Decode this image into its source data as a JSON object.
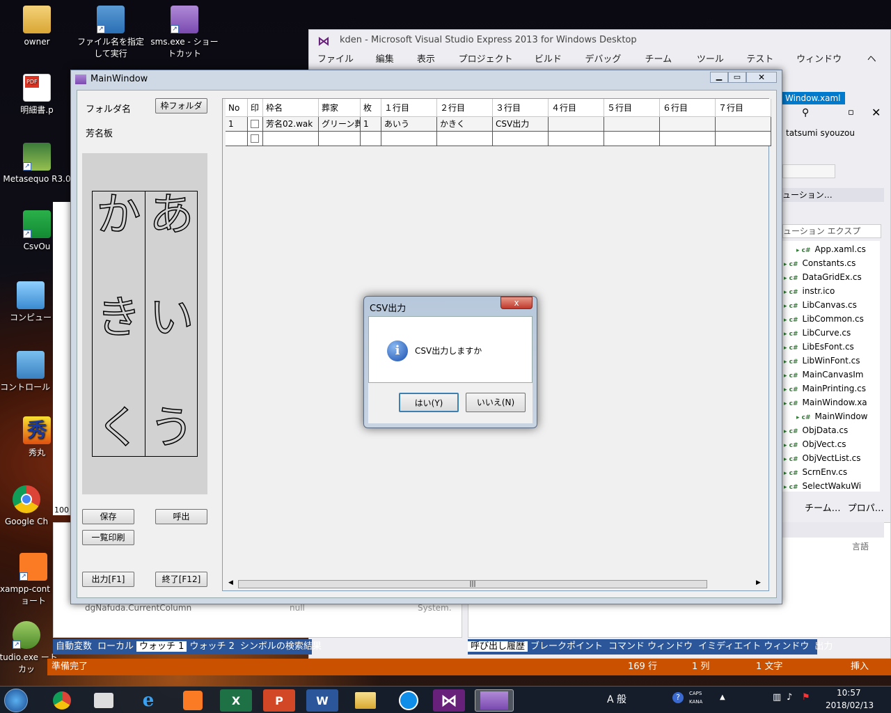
{
  "desktop": {
    "icons": [
      {
        "label": "owner"
      },
      {
        "label": "ファイル名を指定して実行"
      },
      {
        "label": "sms.exe - ショートカット"
      },
      {
        "label": "明細書.p"
      },
      {
        "label": "Metasequo R3.0"
      },
      {
        "label": "CsvOu"
      },
      {
        "label": "コンピュー"
      },
      {
        "label": "コントロール ル"
      },
      {
        "label": "秀丸"
      },
      {
        "label": "Google Ch"
      },
      {
        "label": "xampp-cont - ショート"
      },
      {
        "label": "studio.exe ートカッ"
      }
    ]
  },
  "vs": {
    "title": "kden - Microsoft Visual Studio Express 2013 for Windows Desktop",
    "menu": [
      "ファイル(F)",
      "編集(E)",
      "表示(V)",
      "プロジェクト(P)",
      "ビルド(B)",
      "デバッグ(D)",
      "チーム(M)",
      "ツール(T)",
      "テスト(S)",
      "ウィンドウ(W)",
      "ヘル"
    ],
    "doc_tab": "Window.xaml",
    "user": "tatsumi syouzou",
    "solution_header": "ューション…",
    "solution_search": "ューション エクスプ",
    "files": [
      "App.xaml.cs",
      "Constants.cs",
      "DataGridEx.cs",
      "instr.ico",
      "LibCanvas.cs",
      "LibCommon.cs",
      "LibCurve.cs",
      "LibEsFont.cs",
      "LibWinFont.cs",
      "MainCanvasIm",
      "MainPrinting.cs",
      "MainWindow.xa",
      "MainWindow",
      "ObjData.cs",
      "ObjVect.cs",
      "ObjVectList.cs",
      "ScrnEnv.cs",
      "SelectWakuWi"
    ],
    "right_tabs": [
      "チーム…",
      "プロパ…"
    ],
    "lang_col": "言語",
    "watch_row": "dgNafuda.CurrentColumn",
    "watch_val": "null",
    "watch_type": "System.",
    "zoom": "100",
    "left_tabs": [
      "自動変数",
      "ローカル",
      "ウォッチ 1",
      "ウォッチ 2",
      "シンボルの検索結果"
    ],
    "right_bottom_tabs": [
      "呼び出し履歴",
      "ブレークポイント",
      "コマンド ウィンドウ",
      "イミディエイト ウィンドウ",
      "出力"
    ],
    "status": {
      "ready": "準備完了",
      "line": "169 行",
      "col": "1 列",
      "chars": "1 文字",
      "mode": "挿入"
    }
  },
  "main": {
    "title": "MainWindow",
    "folder_label": "フォルダ名",
    "folder_button": "枠フォルダ",
    "board_label": "芳名板",
    "board_chars": [
      "か",
      "あ",
      "き",
      "い",
      "く",
      "う"
    ],
    "buttons": {
      "save": "保存",
      "call": "呼出",
      "print": "一覧印刷",
      "output": "出力[F1]",
      "exit": "終了[F12]"
    },
    "grid": {
      "headers": [
        "No",
        "印",
        "枠名",
        "葬家",
        "枚",
        "１行目",
        "２行目",
        "３行目",
        "４行目",
        "５行目",
        "６行目",
        "７行目"
      ],
      "rows": [
        [
          "1",
          "",
          "芳名02.wak",
          "グリーン葬",
          "1",
          "あいう",
          "かきく",
          "CSV出力",
          "",
          "",
          "",
          ""
        ],
        [
          "",
          "",
          "",
          "",
          "",
          "",
          "",
          "",
          "",
          "",
          "",
          ""
        ]
      ]
    },
    "scroll_grip": "|||"
  },
  "dialog": {
    "title": "CSV出力",
    "message": "CSV出力しますか",
    "yes": "はい(Y)",
    "no": "いいえ(N)",
    "close": "x"
  },
  "taskbar": {
    "time": "10:57",
    "date": "2018/02/13",
    "ime": "A 般",
    "caps": "CAPS",
    "kana": "KANA",
    "excel": "X",
    "ppt": "P",
    "word": "W"
  }
}
